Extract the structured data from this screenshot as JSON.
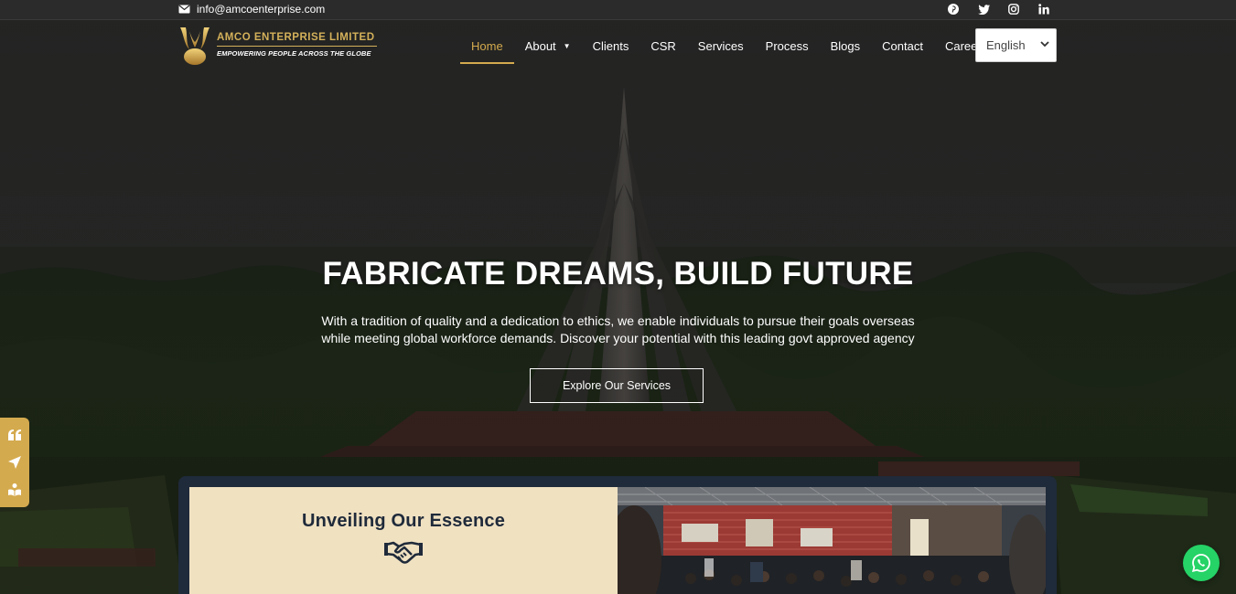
{
  "topbar": {
    "email": "info@amcoenterprise.com",
    "social": [
      "pinterest-icon",
      "twitter-icon",
      "instagram-icon",
      "linkedin-icon"
    ]
  },
  "logo": {
    "name": "AMCO  ENTERPRISE  LIMITED",
    "tagline": "EMPOWERING PEOPLE ACROSS THE GLOBE"
  },
  "nav": {
    "items": [
      {
        "label": "Home",
        "active": true
      },
      {
        "label": "About",
        "has_dropdown": true
      },
      {
        "label": "Clients"
      },
      {
        "label": "CSR"
      },
      {
        "label": "Services"
      },
      {
        "label": "Process"
      },
      {
        "label": "Blogs"
      },
      {
        "label": "Contact"
      },
      {
        "label": "Career"
      }
    ],
    "language": "English"
  },
  "hero": {
    "title": "FABRICATE DREAMS, BUILD FUTURE",
    "subtitle_line1": "With a tradition of quality and a dedication to ethics, we enable individuals to pursue their goals overseas",
    "subtitle_line2": "while meeting global workforce demands. Discover your potential with this leading govt approved agency",
    "cta": "Explore Our Services"
  },
  "side_tools": [
    "quote-icon",
    "location-arrow-icon",
    "reader-icon"
  ],
  "essence": {
    "title": "Unveiling Our Essence",
    "icon": "handshake-icon"
  },
  "colors": {
    "accent": "#d4aa4e",
    "essence_bg": "#f0e1c1",
    "navy": "#1f2a3a",
    "whatsapp": "#25d366"
  }
}
